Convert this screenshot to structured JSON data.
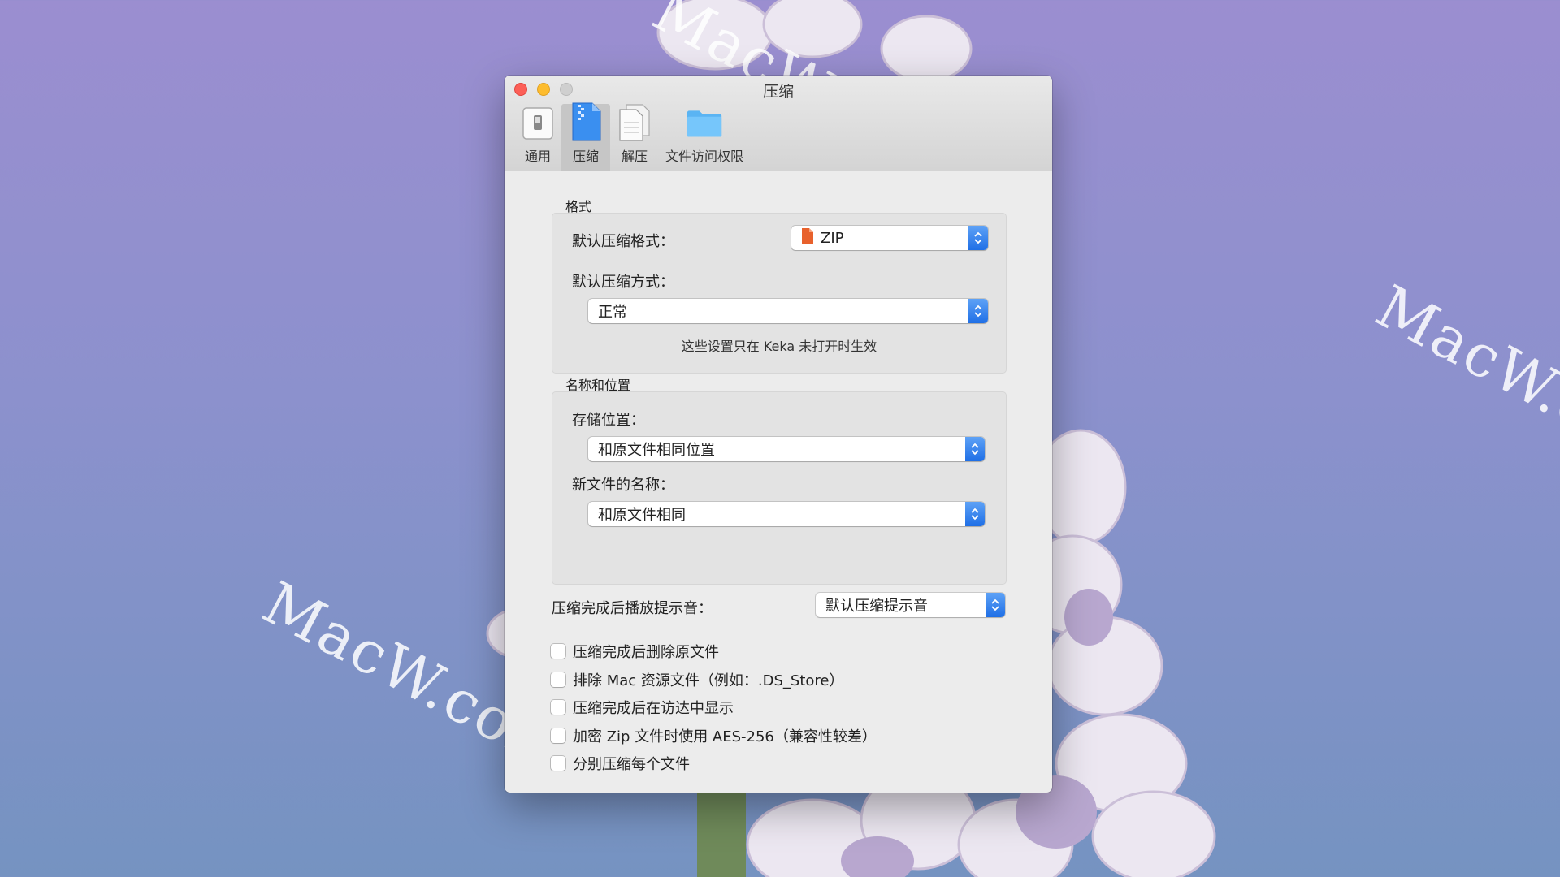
{
  "window": {
    "title": "压缩",
    "tabs": [
      {
        "label": "通用",
        "icon": "switch-icon"
      },
      {
        "label": "压缩",
        "icon": "zip-file-icon"
      },
      {
        "label": "解压",
        "icon": "documents-icon"
      },
      {
        "label": "文件访问权限",
        "icon": "folder-icon"
      }
    ],
    "active_tab": 1
  },
  "format_group": {
    "title": "格式",
    "default_format_label": "默认压缩格式：",
    "default_format_value": "ZIP",
    "default_method_label": "默认压缩方式：",
    "default_method_value": "正常",
    "hint": "这些设置只在 Keka 未打开时生效"
  },
  "name_group": {
    "title": "名称和位置",
    "save_location_label": "存储位置：",
    "save_location_value": "和原文件相同位置",
    "new_name_label": "新文件的名称：",
    "new_name_value": "和原文件相同"
  },
  "sound": {
    "label": "压缩完成后播放提示音：",
    "value": "默认压缩提示音"
  },
  "options": [
    {
      "label": "压缩完成后删除原文件",
      "checked": false
    },
    {
      "label": "排除 Mac 资源文件（例如：.DS_Store）",
      "checked": false
    },
    {
      "label": "压缩完成后在访达中显示",
      "checked": false
    },
    {
      "label": "加密 Zip 文件时使用 AES-256（兼容性较差）",
      "checked": false
    },
    {
      "label": "分别压缩每个文件",
      "checked": false
    }
  ],
  "watermark": "MacW.com",
  "colors": {
    "accent": "#2d7ff0",
    "close": "#fc5f57",
    "minimize": "#fdbc2e",
    "zip_icon": "#e8612c"
  }
}
